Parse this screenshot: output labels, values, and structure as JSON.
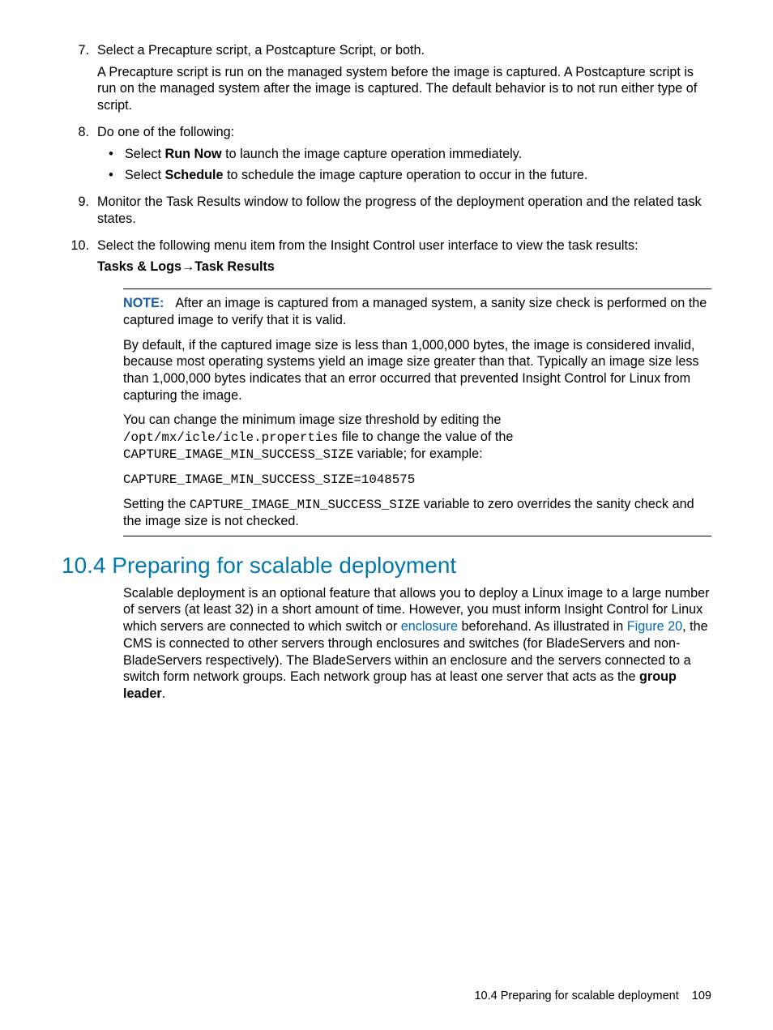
{
  "list": {
    "i7": {
      "num": "7.",
      "p1": "Select a Precapture script, a Postcapture Script, or both.",
      "p2": "A Precapture script is run on the managed system before the image is captured. A Postcapture script is run on the managed system after the image is captured. The default behavior is to not run either type of script."
    },
    "i8": {
      "num": "8.",
      "p1": "Do one of the following:",
      "b1a": "Select ",
      "b1bold": "Run Now",
      "b1b": " to launch the image capture operation immediately.",
      "b2a": "Select ",
      "b2bold": "Schedule",
      "b2b": " to schedule the image capture operation to occur in the future."
    },
    "i9": {
      "num": "9.",
      "p1": "Monitor the Task Results window to follow the progress of the deployment operation and the related task states."
    },
    "i10": {
      "num": "10.",
      "p1": "Select the following menu item from the Insight Control user interface to view the task results:",
      "menu": "Tasks & Logs→Task Results"
    }
  },
  "note": {
    "label": "NOTE:",
    "p1": "After an image is captured from a managed system, a sanity size check is performed on the captured image to verify that it is valid.",
    "p2": "By default, if the captured image size is less than 1,000,000 bytes, the image is considered invalid, because most operating systems yield an image size greater than that. Typically an image size less than 1,000,000 bytes indicates that an error occurred that prevented Insight Control for Linux from capturing the image.",
    "p3a": "You can change the minimum image size threshold by editing the ",
    "p3path": "/opt/mx/icle/icle.properties",
    "p3b": " file to change the value of the ",
    "p3var": "CAPTURE_IMAGE_MIN_SUCCESS_SIZE",
    "p3c": " variable; for example:",
    "code": "CAPTURE_IMAGE_MIN_SUCCESS_SIZE=1048575",
    "p4a": "Setting the ",
    "p4var": "CAPTURE_IMAGE_MIN_SUCCESS_SIZE",
    "p4b": " variable to zero overrides the sanity check and the image size is not checked."
  },
  "section": {
    "heading": "10.4 Preparing for scalable deployment",
    "p1a": "Scalable deployment is an optional feature that allows you to deploy a Linux image to a large number of servers (at least 32) in a short amount of time. However, you must inform Insight Control for Linux which servers are connected to which switch or ",
    "link1": "enclosure",
    "p1b": " beforehand. As illustrated in ",
    "link2": "Figure 20",
    "p1c": ", the CMS is connected to other servers through enclosures and switches (for BladeServers and non-BladeServers respectively). The BladeServers within an enclosure and the servers connected to a switch form network groups. Each network group has at least one server that acts as the ",
    "bold": "group leader",
    "p1d": "."
  },
  "footer": {
    "text": "10.4 Preparing for scalable deployment",
    "page": "109"
  }
}
